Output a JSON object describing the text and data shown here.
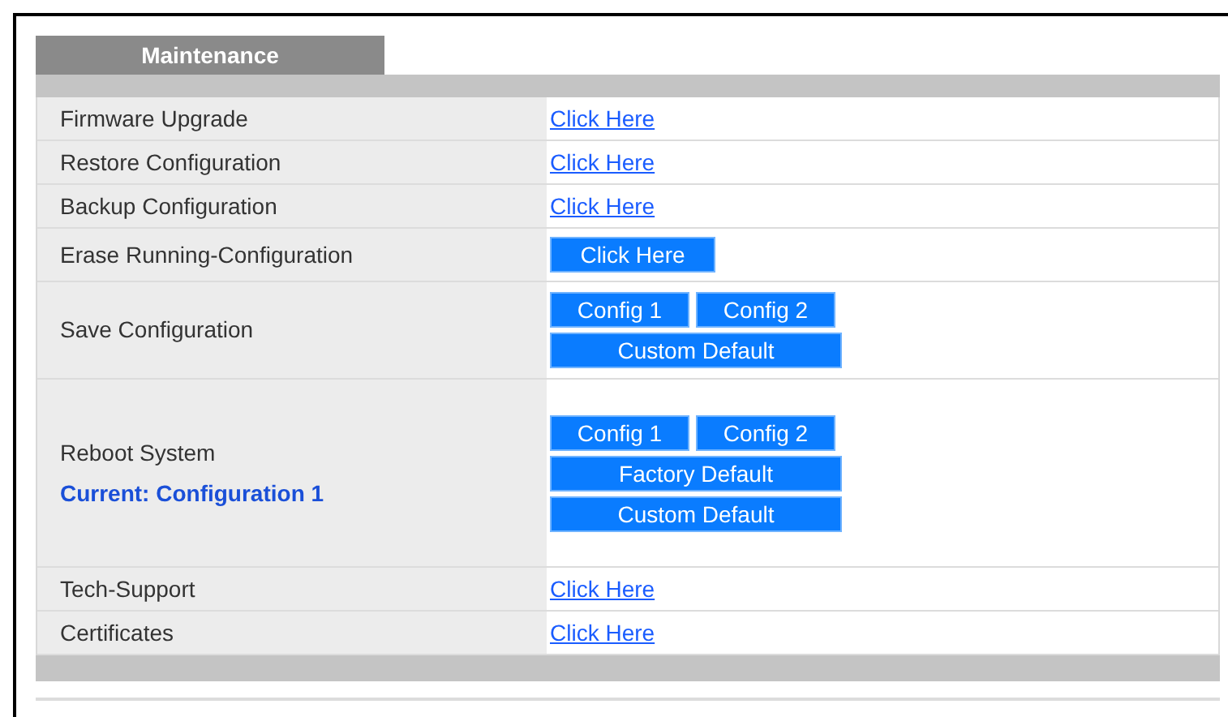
{
  "tab": {
    "label": "Maintenance",
    "selected": true
  },
  "rows": [
    {
      "label": "Firmware Upgrade",
      "kind": "link",
      "link": "Click Here"
    },
    {
      "label": "Restore Configuration",
      "kind": "link",
      "link": "Click Here"
    },
    {
      "label": "Backup Configuration",
      "kind": "link",
      "link": "Click Here"
    },
    {
      "label": "Erase Running-Configuration",
      "kind": "buttons",
      "button_rows": [
        [
          "Click Here"
        ]
      ]
    },
    {
      "label": "Save Configuration",
      "kind": "buttons",
      "button_rows": [
        [
          "Config 1",
          "Config 2"
        ],
        [
          "Custom Default"
        ]
      ]
    },
    {
      "label": "Reboot System",
      "note": "Current: Configuration 1",
      "kind": "buttons",
      "button_rows": [
        [
          "Config 1",
          "Config 2"
        ],
        [
          "Factory Default"
        ],
        [
          "Custom Default"
        ]
      ]
    },
    {
      "label": "Tech-Support",
      "kind": "link",
      "link": "Click Here"
    },
    {
      "label": "Certificates",
      "kind": "link",
      "link": "Click Here"
    }
  ]
}
